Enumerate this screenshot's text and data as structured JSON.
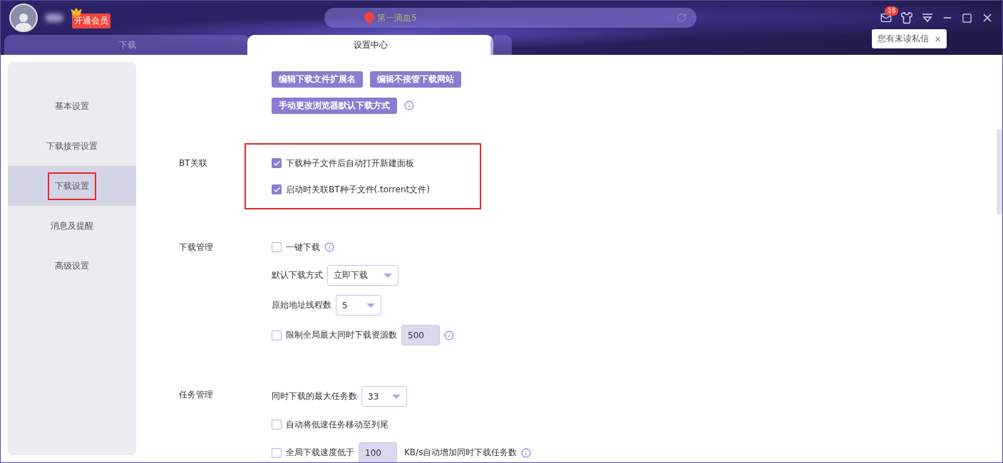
{
  "header": {
    "vip_badge": "开通会员",
    "search": {
      "value": "第一滴血5"
    },
    "mail_count": "16",
    "tooltip": "您有未读私信",
    "tooltip_close": "×"
  },
  "tabs": [
    {
      "label": "下载",
      "selected": false
    },
    {
      "label": "设置中心",
      "selected": true
    },
    {
      "selected": false
    }
  ],
  "sidebar": {
    "items": [
      {
        "label": "基本设置",
        "selected": false,
        "highlighted": false
      },
      {
        "label": "下载接管设置",
        "selected": false,
        "highlighted": false
      },
      {
        "label": "下载设置",
        "selected": true,
        "highlighted": true
      },
      {
        "label": "消息及提醒",
        "selected": false,
        "highlighted": false
      },
      {
        "label": "高级设置",
        "selected": false,
        "highlighted": false
      }
    ]
  },
  "sections": [
    {
      "highlighted": false,
      "rows": [
        {
          "kind": "buttons",
          "buttons": [
            "编辑下载文件扩展名",
            "编辑不接管下载网站"
          ],
          "info": false
        },
        {
          "kind": "buttons",
          "buttons": [
            "手动更改浏览器默认下载方式"
          ],
          "info": true
        }
      ]
    },
    {
      "label": "BT关联",
      "highlighted": true,
      "rows": [
        {
          "kind": "checkbox",
          "label": "下载种子文件后自动打开新建面板",
          "checked": true,
          "info": false
        },
        {
          "kind": "checkbox",
          "label": "启动时关联BT种子文件(.torrent文件)",
          "checked": true,
          "info": false
        }
      ]
    },
    {
      "label": "下载管理",
      "highlighted": false,
      "rows": [
        {
          "kind": "checkbox",
          "label": "一键下载",
          "checked": false,
          "info": true
        },
        {
          "kind": "select",
          "label": "默认下载方式",
          "value": "立即下载",
          "wide": true
        },
        {
          "kind": "select",
          "label": "原始地址线程数",
          "value": "5",
          "wide": false
        },
        {
          "kind": "checkbox-input",
          "label": "限制全局最大同时下载资源数",
          "checked": false,
          "value": "500",
          "info": true
        }
      ]
    },
    {
      "label": "任务管理",
      "highlighted": false,
      "rows": [
        {
          "kind": "select",
          "label": "同时下载的最大任务数",
          "value": "33",
          "wide": false
        },
        {
          "kind": "checkbox",
          "label": "自动将低速任务移动至列尾",
          "checked": false,
          "info": false
        },
        {
          "kind": "checkbox-input",
          "label": "全局下载速度低于",
          "checked": false,
          "value": "100",
          "suffix": "KB/s自动增加同时下载任务数",
          "info": true
        }
      ]
    }
  ]
}
